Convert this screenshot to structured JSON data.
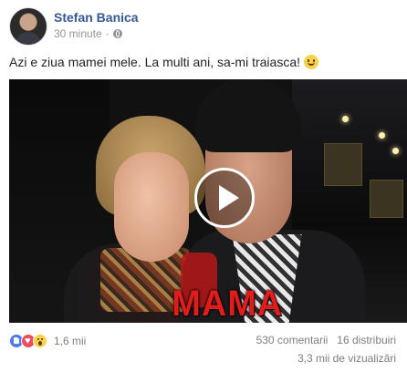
{
  "post": {
    "author": "Stefan Banica",
    "time": "30 minute",
    "separator": "·",
    "privacy_icon": "globe-icon",
    "text": "Azi e ziua mamei mele. La multi ani, sa-mi traiasca!",
    "emoji": "smiley-icon"
  },
  "video": {
    "overlay_text": "MAMA",
    "play_icon": "play-icon",
    "overlay_color": "#e21b1b"
  },
  "footer": {
    "reaction_icons": [
      "like-icon",
      "love-icon",
      "wow-icon"
    ],
    "reactions_count": "1,6 mii",
    "comments": "530 comentarii",
    "shares": "16 distribuiri",
    "views": "3,3 mii de vizualizări"
  },
  "colors": {
    "author_link": "#365899",
    "meta_text": "#90949c",
    "like": "#4b7bec",
    "love": "#ee4d5f"
  }
}
